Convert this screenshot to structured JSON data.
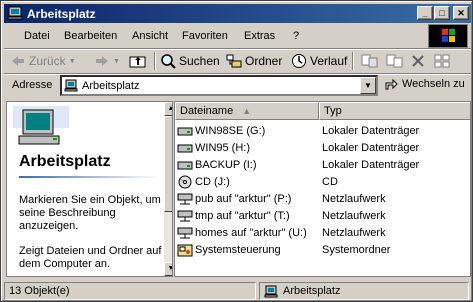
{
  "window": {
    "title": "Arbeitsplatz"
  },
  "menu": [
    "Datei",
    "Bearbeiten",
    "Ansicht",
    "Favoriten",
    "Extras",
    "?"
  ],
  "toolbar": {
    "back": "Zurück",
    "search": "Suchen",
    "folders": "Ordner",
    "history": "Verlauf"
  },
  "address": {
    "label": "Adresse",
    "value": "Arbeitsplatz",
    "go": "Wechseln zu"
  },
  "leftpane": {
    "title": "Arbeitsplatz",
    "desc": "Markieren Sie ein Objekt, um seine Beschreibung anzuzeigen.",
    "desc2": "Zeigt Dateien und Ordner auf dem Computer an."
  },
  "columns": {
    "name": "Dateiname",
    "type": "Typ"
  },
  "rows": [
    {
      "name": "WIN98SE (G:)",
      "type": "Lokaler Datenträger",
      "icon": "drive-icon"
    },
    {
      "name": "WIN95 (H:)",
      "type": "Lokaler Datenträger",
      "icon": "drive-icon"
    },
    {
      "name": "BACKUP (I:)",
      "type": "Lokaler Datenträger",
      "icon": "drive-icon"
    },
    {
      "name": "CD (J:)",
      "type": "CD",
      "icon": "cd-icon"
    },
    {
      "name": "pub auf \"arktur\" (P:)",
      "type": "Netzlaufwerk",
      "icon": "network-drive-icon"
    },
    {
      "name": "tmp auf \"arktur\" (T:)",
      "type": "Netzlaufwerk",
      "icon": "network-drive-icon"
    },
    {
      "name": "homes auf \"arktur\" (U:)",
      "type": "Netzlaufwerk",
      "icon": "network-drive-icon"
    },
    {
      "name": "Systemsteuerung",
      "type": "Systemordner",
      "icon": "control-panel-icon"
    }
  ],
  "status": {
    "count": "13 Objekt(e)",
    "location": "Arbeitsplatz"
  }
}
